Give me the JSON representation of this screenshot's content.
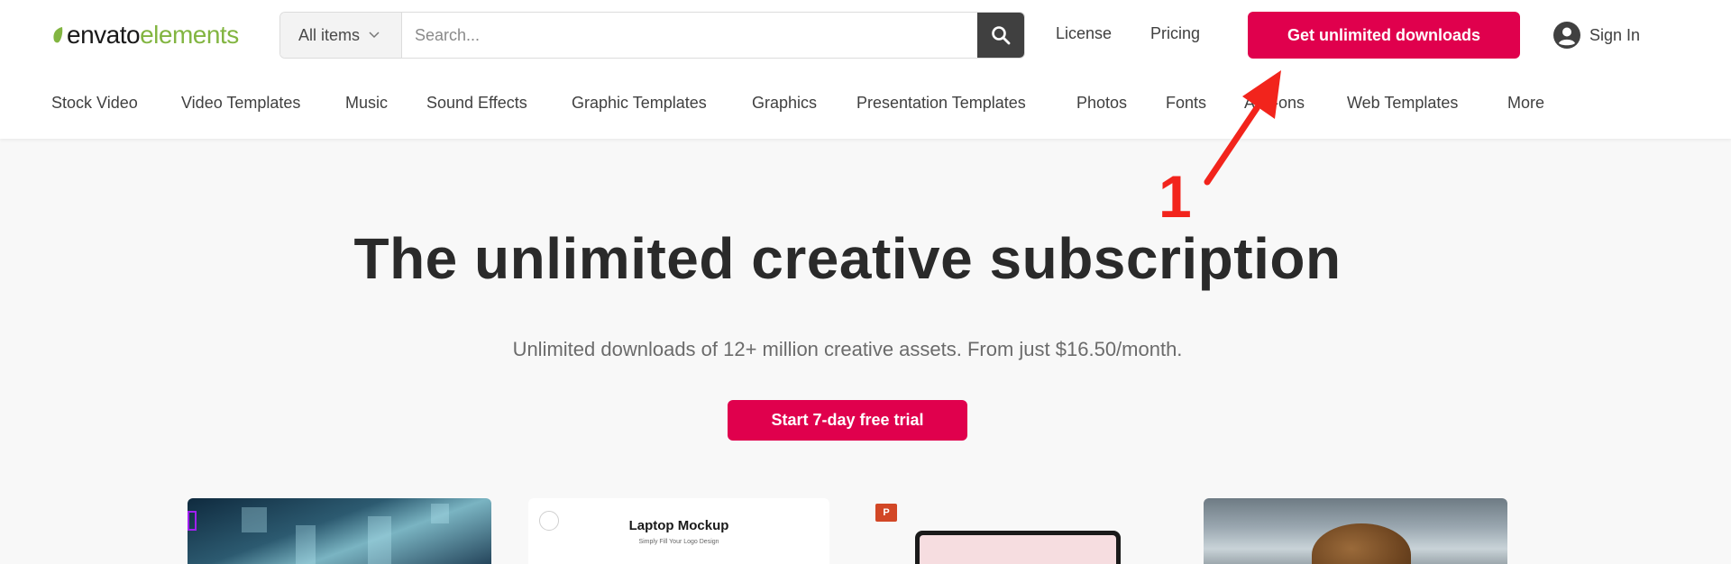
{
  "header": {
    "logo": {
      "part1": "envato",
      "part2": "elements"
    },
    "search": {
      "category_selected": "All items",
      "placeholder": "Search..."
    },
    "links": {
      "license": "License",
      "pricing": "Pricing"
    },
    "cta_label": "Get unlimited downloads",
    "sign_in_label": "Sign In"
  },
  "nav": {
    "items": [
      {
        "label": "Stock Video"
      },
      {
        "label": "Video Templates"
      },
      {
        "label": "Music"
      },
      {
        "label": "Sound Effects"
      },
      {
        "label": "Graphic Templates"
      },
      {
        "label": "Graphics"
      },
      {
        "label": "Presentation Templates"
      },
      {
        "label": "Photos"
      },
      {
        "label": "Fonts"
      },
      {
        "label": "Add-ons"
      },
      {
        "label": "Web Templates"
      },
      {
        "label": "More"
      }
    ]
  },
  "hero": {
    "title": "The unlimited creative subscription",
    "subtitle": "Unlimited downloads of 12+ million creative assets. From just $16.50/month.",
    "trial_label": "Start 7-day free trial"
  },
  "cards": {
    "laptop": {
      "title": "Laptop Mockup",
      "subtitle": "Simply Fill Your Logo Design"
    },
    "presentation": {
      "badge": "P"
    }
  },
  "annotation": {
    "step_number": "1",
    "color": "#f2241c"
  },
  "colors": {
    "brand_green": "#82b541",
    "cta_pink": "#e0004d",
    "background": "#f8f8f8"
  }
}
